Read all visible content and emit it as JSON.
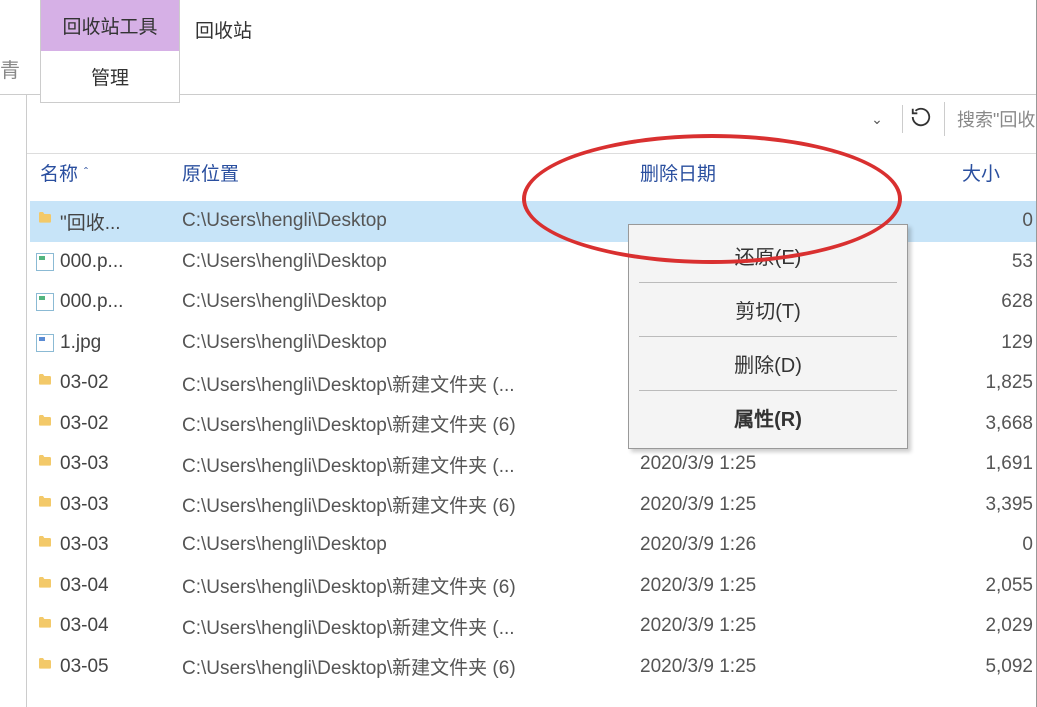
{
  "ribbon": {
    "context_tab": "回收站工具",
    "manage_tab": "管理",
    "window_title": "回收站",
    "left_stub": "青"
  },
  "addressbar": {
    "search_placeholder": "搜索\"回收"
  },
  "columns": {
    "name": "名称",
    "location": "原位置",
    "date_deleted": "删除日期",
    "size": "大小"
  },
  "rows": [
    {
      "icon": "folder",
      "name": "\"回收...",
      "location": "C:\\Users\\hengli\\Desktop",
      "date": "",
      "size": "0"
    },
    {
      "icon": "img-green",
      "name": "000.p...",
      "location": "C:\\Users\\hengli\\Desktop",
      "date": "",
      "size": "53"
    },
    {
      "icon": "img-green",
      "name": "000.p...",
      "location": "C:\\Users\\hengli\\Desktop",
      "date": "",
      "size": "628"
    },
    {
      "icon": "img-blue",
      "name": "1.jpg",
      "location": "C:\\Users\\hengli\\Desktop",
      "date": "",
      "size": "129"
    },
    {
      "icon": "folder",
      "name": "03-02",
      "location": "C:\\Users\\hengli\\Desktop\\新建文件夹 (...",
      "date": "",
      "size": "1,825"
    },
    {
      "icon": "folder",
      "name": "03-02",
      "location": "C:\\Users\\hengli\\Desktop\\新建文件夹 (6)",
      "date": "",
      "size": "3,668"
    },
    {
      "icon": "folder",
      "name": "03-03",
      "location": "C:\\Users\\hengli\\Desktop\\新建文件夹 (...",
      "date": "2020/3/9 1:25",
      "size": "1,691"
    },
    {
      "icon": "folder",
      "name": "03-03",
      "location": "C:\\Users\\hengli\\Desktop\\新建文件夹 (6)",
      "date": "2020/3/9 1:25",
      "size": "3,395"
    },
    {
      "icon": "folder",
      "name": "03-03",
      "location": "C:\\Users\\hengli\\Desktop",
      "date": "2020/3/9 1:26",
      "size": "0"
    },
    {
      "icon": "folder",
      "name": "03-04",
      "location": "C:\\Users\\hengli\\Desktop\\新建文件夹 (6)",
      "date": "2020/3/9 1:25",
      "size": "2,055"
    },
    {
      "icon": "folder",
      "name": "03-04",
      "location": "C:\\Users\\hengli\\Desktop\\新建文件夹 (...",
      "date": "2020/3/9 1:25",
      "size": "2,029"
    },
    {
      "icon": "folder",
      "name": "03-05",
      "location": "C:\\Users\\hengli\\Desktop\\新建文件夹 (6)",
      "date": "2020/3/9 1:25",
      "size": "5,092"
    }
  ],
  "context_menu": {
    "restore": "还原(E)",
    "cut": "剪切(T)",
    "delete": "删除(D)",
    "properties": "属性(R)"
  }
}
